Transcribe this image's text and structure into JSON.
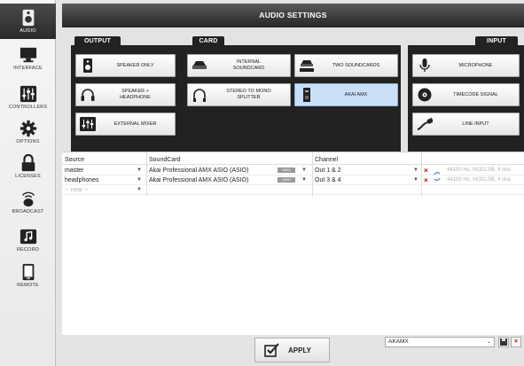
{
  "sidebar": {
    "items": [
      {
        "label": "AUDIO",
        "icon": "speaker-icon",
        "active": true
      },
      {
        "label": "INTERFACE",
        "icon": "monitor-icon"
      },
      {
        "label": "CONTROLLERS",
        "icon": "sliders-icon"
      },
      {
        "label": "OPTIONS",
        "icon": "gear-icon"
      },
      {
        "label": "LICENSES",
        "icon": "lock-icon"
      },
      {
        "label": "BROADCAST",
        "icon": "broadcast-icon"
      },
      {
        "label": "RECORD",
        "icon": "music-note-icon"
      },
      {
        "label": "REMOTE",
        "icon": "tablet-icon"
      }
    ]
  },
  "window": {
    "title": "AUDIO SETTINGS"
  },
  "groups": {
    "output": "OUTPUT",
    "card": "CARD",
    "input": "INPUT"
  },
  "output_buttons": [
    {
      "label": "SPEAKER ONLY",
      "icon": "speaker-icon"
    },
    {
      "label": "SPEAKER +\nHEADPHONE",
      "icon": "headphone-icon"
    },
    {
      "label": "EXTERNAL MIXER",
      "icon": "mixer-icon"
    }
  ],
  "card_buttons": [
    {
      "label": "INTERNAL\nSOUNDCARD",
      "icon": "soundcard-icon"
    },
    {
      "label": "TWO SOUNDCARDS",
      "icon": "two-soundcards-icon"
    },
    {
      "label": "STEREO TO MONO\nSPLITTER",
      "icon": "splitter-icon"
    },
    {
      "label": "AKAI AMX",
      "icon": "akai-amx-icon",
      "selected": true
    }
  ],
  "input_buttons": [
    {
      "label": "MICROPHONE",
      "icon": "microphone-icon"
    },
    {
      "label": "TIMECODE SIGNAL",
      "icon": "vinyl-icon"
    },
    {
      "label": "LINE INPUT",
      "icon": "cable-icon"
    }
  ],
  "table": {
    "headers": {
      "source": "Source",
      "soundcard": "SoundCard",
      "channel": "Channel"
    },
    "rows": [
      {
        "source": "master",
        "soundcard": "Akai Professional AMX ASIO (ASIO)",
        "badge": "ASIO",
        "channel": "Out 1 & 2",
        "info": "44100 Hz, Int32LSB, 4 cha"
      },
      {
        "source": "headphones",
        "soundcard": "Akai Professional AMX ASIO (ASIO)",
        "badge": "ASIO",
        "channel": "Out 3 & 4",
        "info": "44100 Hz, Int32LSB, 4 cha"
      },
      {
        "source": "-- new --"
      }
    ]
  },
  "footer": {
    "apply": "APPLY",
    "preset": "AKAMX"
  }
}
